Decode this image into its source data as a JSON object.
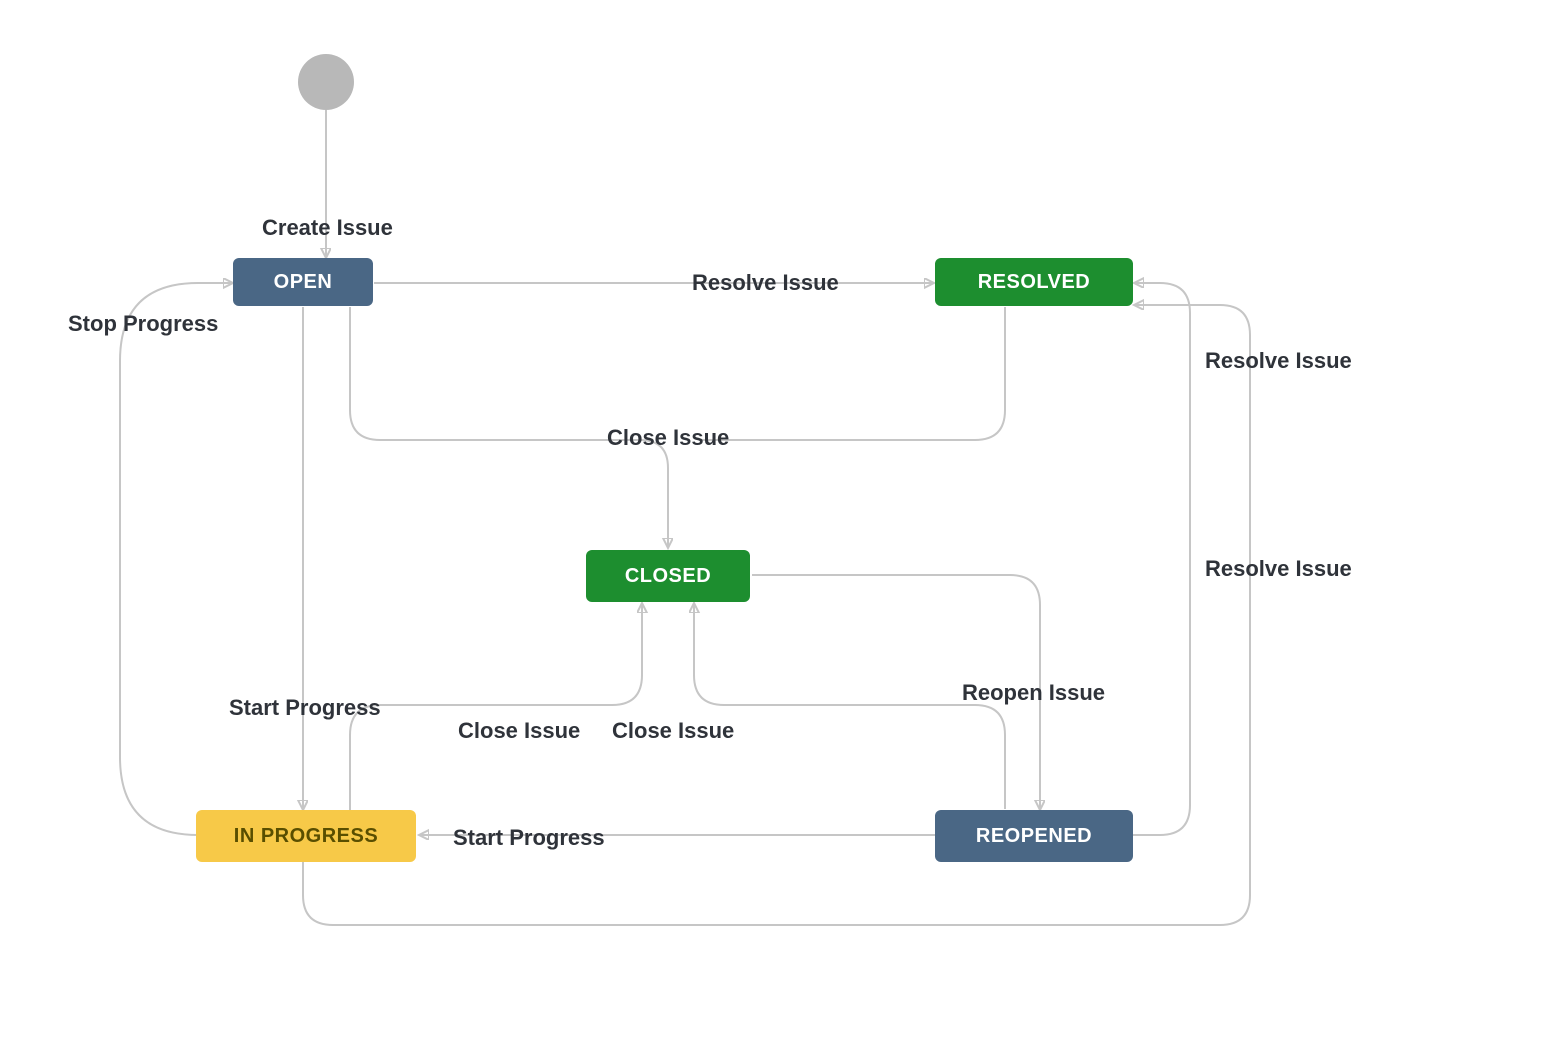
{
  "states": {
    "open": "OPEN",
    "resolved": "RESOLVED",
    "closed": "CLOSED",
    "in_progress": "IN PROGRESS",
    "reopened": "REOPENED"
  },
  "transitions": {
    "create_issue": "Create Issue",
    "resolve_issue": "Resolve Issue",
    "stop_progress": "Stop Progress",
    "close_issue": "Close Issue",
    "start_progress": "Start Progress",
    "reopen_issue": "Reopen Issue",
    "resolve_issue_reopened": "Resolve Issue",
    "resolve_issue_inprog": "Resolve Issue",
    "close_issue_inprog": "Close Issue",
    "close_issue_reopened": "Close Issue",
    "start_progress_reopened": "Start Progress"
  },
  "colors": {
    "blue": "#4a6785",
    "green": "#1d8e2f",
    "yellow": "#f7c948",
    "edge": "#c6c6c6",
    "text": "#2f333a"
  }
}
